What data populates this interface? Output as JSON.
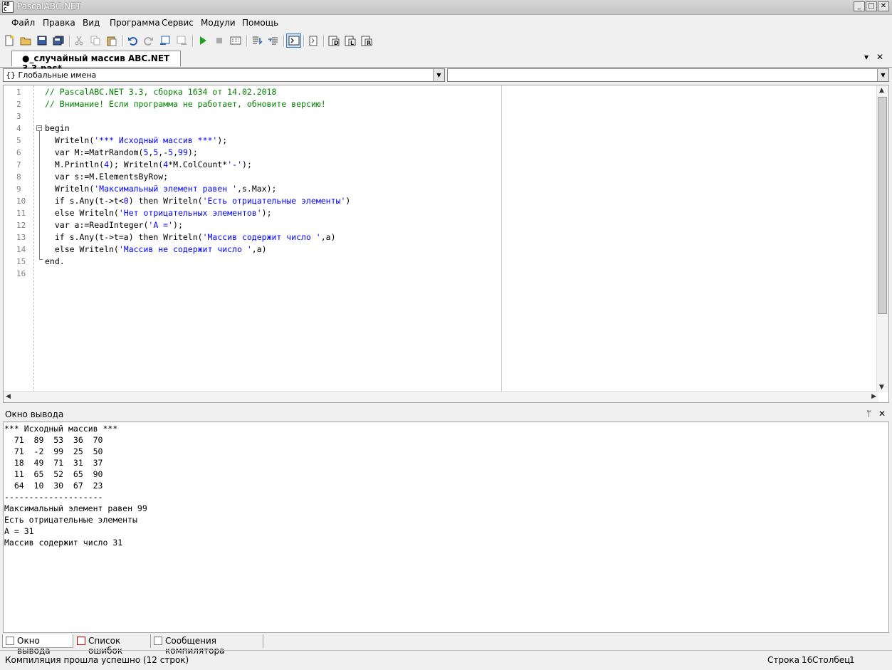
{
  "window": {
    "title": "PascalABC.NET",
    "app_icon_text": "AB C"
  },
  "menu": [
    "Файл",
    "Правка",
    "Вид",
    "Программа",
    "Сервис",
    "Модули",
    "Помощь"
  ],
  "tab": {
    "label": "●_случайный массив ABC.NET 3.3.pas*"
  },
  "combo_left": {
    "value": "{} Глобальные имена"
  },
  "combo_right": {
    "value": ""
  },
  "editor": {
    "line_numbers": [
      "1",
      "2",
      "3",
      "4",
      "5",
      "6",
      "7",
      "8",
      "9",
      "10",
      "11",
      "12",
      "13",
      "14",
      "15",
      "16"
    ],
    "lines": [
      [
        {
          "t": "// PascalABC.NET 3.3, сборка 1634 от 14.02.2018",
          "c": "com"
        }
      ],
      [
        {
          "t": "// Внимание! Если программа не работает, обновите версию!",
          "c": "com"
        }
      ],
      [],
      [
        {
          "t": "begin",
          "c": "kw"
        }
      ],
      [
        {
          "t": "  Writeln(",
          "c": "kw"
        },
        {
          "t": "'*** Исходный массив ***'",
          "c": "str"
        },
        {
          "t": ");",
          "c": "kw"
        }
      ],
      [
        {
          "t": "  var M:=MatrRandom(",
          "c": "kw"
        },
        {
          "t": "5",
          "c": "str"
        },
        {
          "t": ",",
          "c": "kw"
        },
        {
          "t": "5",
          "c": "str"
        },
        {
          "t": ",-",
          "c": "kw"
        },
        {
          "t": "5",
          "c": "str"
        },
        {
          "t": ",",
          "c": "kw"
        },
        {
          "t": "99",
          "c": "str"
        },
        {
          "t": ");",
          "c": "kw"
        }
      ],
      [
        {
          "t": "  M.Println(",
          "c": "kw"
        },
        {
          "t": "4",
          "c": "str"
        },
        {
          "t": "); Writeln(",
          "c": "kw"
        },
        {
          "t": "4",
          "c": "str"
        },
        {
          "t": "*M.ColCount*",
          "c": "kw"
        },
        {
          "t": "'-'",
          "c": "str"
        },
        {
          "t": ");",
          "c": "kw"
        }
      ],
      [
        {
          "t": "  var s:=M.ElementsByRow;",
          "c": "kw"
        }
      ],
      [
        {
          "t": "  Writeln(",
          "c": "kw"
        },
        {
          "t": "'Максимальный элемент равен '",
          "c": "str"
        },
        {
          "t": ",s.Max);",
          "c": "kw"
        }
      ],
      [
        {
          "t": "  if s.Any(t->t<",
          "c": "kw"
        },
        {
          "t": "0",
          "c": "str"
        },
        {
          "t": ") then Writeln(",
          "c": "kw"
        },
        {
          "t": "'Есть отрицательные элементы'",
          "c": "str"
        },
        {
          "t": ")",
          "c": "kw"
        }
      ],
      [
        {
          "t": "  else Writeln(",
          "c": "kw"
        },
        {
          "t": "'Нет отрицательных элементов'",
          "c": "str"
        },
        {
          "t": ");",
          "c": "kw"
        }
      ],
      [
        {
          "t": "  var a:=ReadInteger(",
          "c": "kw"
        },
        {
          "t": "'A ='",
          "c": "str"
        },
        {
          "t": ");",
          "c": "kw"
        }
      ],
      [
        {
          "t": "  if s.Any(t->t=a) then Writeln(",
          "c": "kw"
        },
        {
          "t": "'Массив содержит число '",
          "c": "str"
        },
        {
          "t": ",a)",
          "c": "kw"
        }
      ],
      [
        {
          "t": "  else Writeln(",
          "c": "kw"
        },
        {
          "t": "'Массив не содержит число '",
          "c": "str"
        },
        {
          "t": ",a)",
          "c": "kw"
        }
      ],
      [
        {
          "t": "end.",
          "c": "kw"
        }
      ],
      []
    ]
  },
  "output_panel": {
    "title": "Окно вывода",
    "lines": [
      "*** Исходный массив ***",
      "  71  89  53  36  70",
      "  71  -2  99  25  50",
      "  18  49  71  31  37",
      "  11  65  52  65  90",
      "  64  10  30  67  23",
      "--------------------",
      "Максимальный элемент равен 99",
      "Есть отрицательные элементы",
      "A = 31",
      "Массив содержит число 31"
    ]
  },
  "bottom_tabs": [
    "Окно вывода",
    "Список ошибок",
    "Сообщения компилятора"
  ],
  "status": {
    "message": "Компиляция прошла успешно (12 строк)",
    "row_label": "Строка",
    "row_value": "16",
    "col_label": "Столбец",
    "col_value": "1"
  },
  "icons": {
    "toolbar": [
      "new-file-icon",
      "open-icon",
      "save-icon",
      "save-all-icon",
      "cut-icon",
      "copy-icon",
      "paste-icon",
      "undo-icon",
      "redo-icon",
      "bookmark-prev-icon",
      "bookmark-next-icon",
      "run-icon",
      "stop-icon",
      "debug-icon",
      "step-over-icon",
      "step-into-icon",
      "console-icon",
      "format-icon",
      "ref-d-icon",
      "ref-l-icon",
      "ref-r-icon"
    ]
  },
  "colors": {
    "comment": "#008000",
    "string": "#0000ff",
    "keyword": "#000000"
  }
}
